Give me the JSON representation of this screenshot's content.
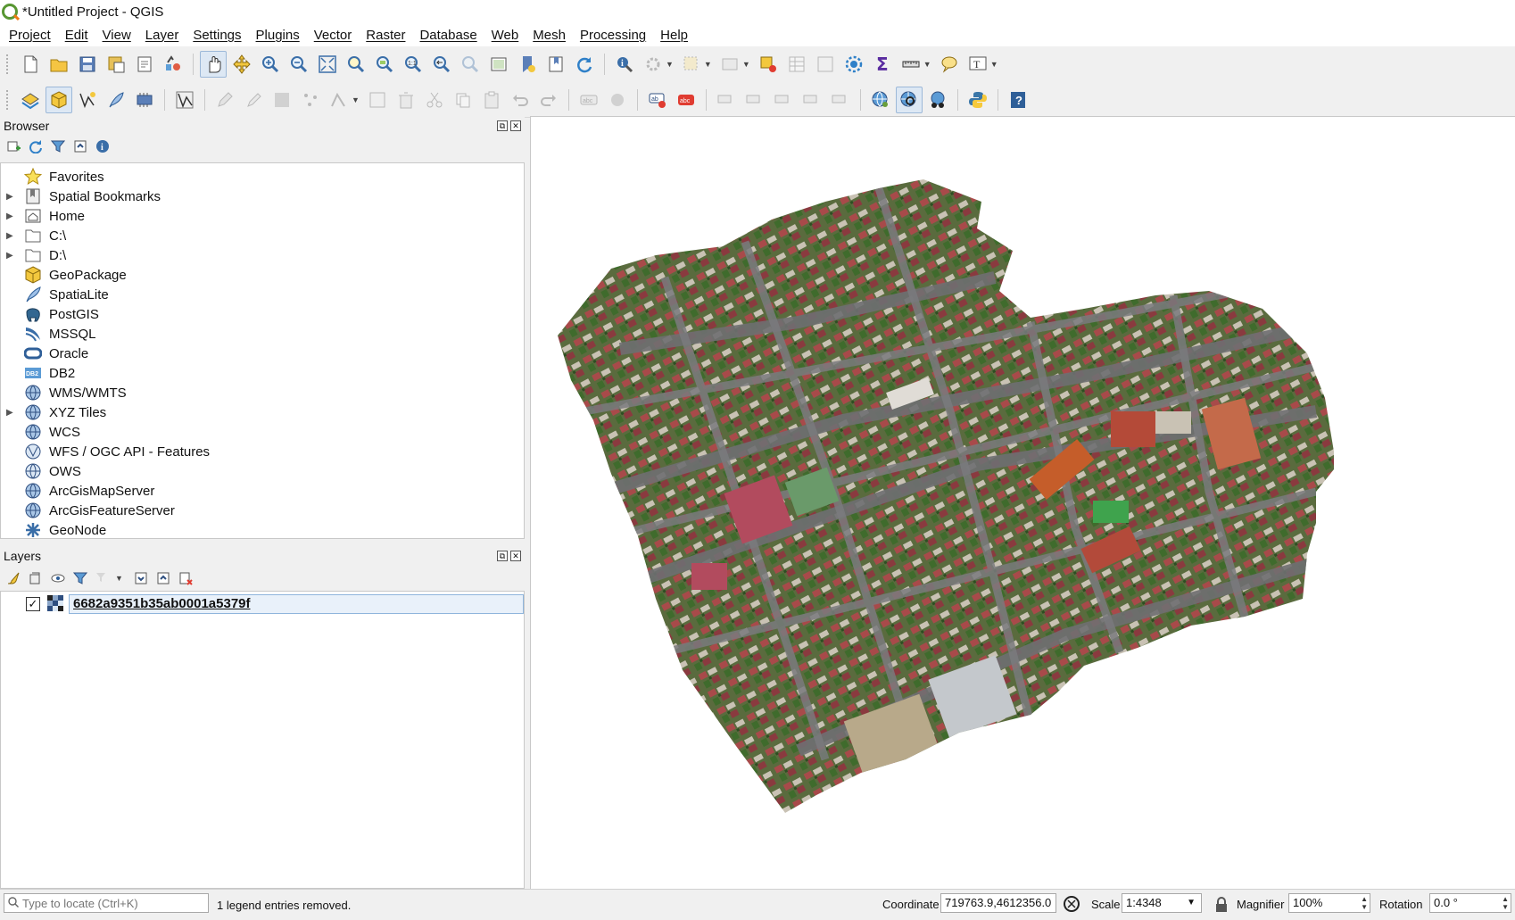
{
  "window": {
    "title": "*Untitled Project - QGIS"
  },
  "menus": [
    "Project",
    "Edit",
    "View",
    "Layer",
    "Settings",
    "Plugins",
    "Vector",
    "Raster",
    "Database",
    "Web",
    "Mesh",
    "Processing",
    "Help"
  ],
  "browser": {
    "title": "Browser",
    "items": [
      {
        "label": "Favorites",
        "icon": "star-icon",
        "expandable": false
      },
      {
        "label": "Spatial Bookmarks",
        "icon": "bookmark-icon",
        "expandable": true
      },
      {
        "label": "Home",
        "icon": "home-icon",
        "expandable": true
      },
      {
        "label": "C:\\",
        "icon": "folder-icon",
        "expandable": true
      },
      {
        "label": "D:\\",
        "icon": "folder-icon",
        "expandable": true
      },
      {
        "label": "GeoPackage",
        "icon": "geopackage-icon",
        "expandable": false
      },
      {
        "label": "SpatiaLite",
        "icon": "feather-icon",
        "expandable": false
      },
      {
        "label": "PostGIS",
        "icon": "elephant-icon",
        "expandable": false
      },
      {
        "label": "MSSQL",
        "icon": "mssql-icon",
        "expandable": false
      },
      {
        "label": "Oracle",
        "icon": "oracle-icon",
        "expandable": false
      },
      {
        "label": "DB2",
        "icon": "db2-icon",
        "expandable": false
      },
      {
        "label": "WMS/WMTS",
        "icon": "globe-icon",
        "expandable": false
      },
      {
        "label": "XYZ Tiles",
        "icon": "globe-icon",
        "expandable": true
      },
      {
        "label": "WCS",
        "icon": "globe-icon",
        "expandable": false
      },
      {
        "label": "WFS / OGC API - Features",
        "icon": "globe-icon",
        "expandable": false
      },
      {
        "label": "OWS",
        "icon": "globe-icon",
        "expandable": false
      },
      {
        "label": "ArcGisMapServer",
        "icon": "globe-icon",
        "expandable": false
      },
      {
        "label": "ArcGisFeatureServer",
        "icon": "globe-icon",
        "expandable": false
      },
      {
        "label": "GeoNode",
        "icon": "geonode-icon",
        "expandable": false
      }
    ]
  },
  "layers": {
    "title": "Layers",
    "items": [
      {
        "name": "6682a9351b35ab0001a5379f",
        "checked": true,
        "icon": "raster-icon"
      }
    ]
  },
  "status": {
    "locator_placeholder": "Type to locate (Ctrl+K)",
    "message": "1 legend entries removed.",
    "coordinate_label": "Coordinate",
    "coordinate_value": "719763.9,4612356.0",
    "scale_label": "Scale",
    "scale_value": "1:4348",
    "magnifier_label": "Magnifier",
    "magnifier_value": "100%",
    "rotation_label": "Rotation",
    "rotation_value": "0.0 °"
  },
  "colors": {
    "accent": "#589632",
    "highlight": "#e9f1fa",
    "qgis_orange": "#ee7913"
  }
}
